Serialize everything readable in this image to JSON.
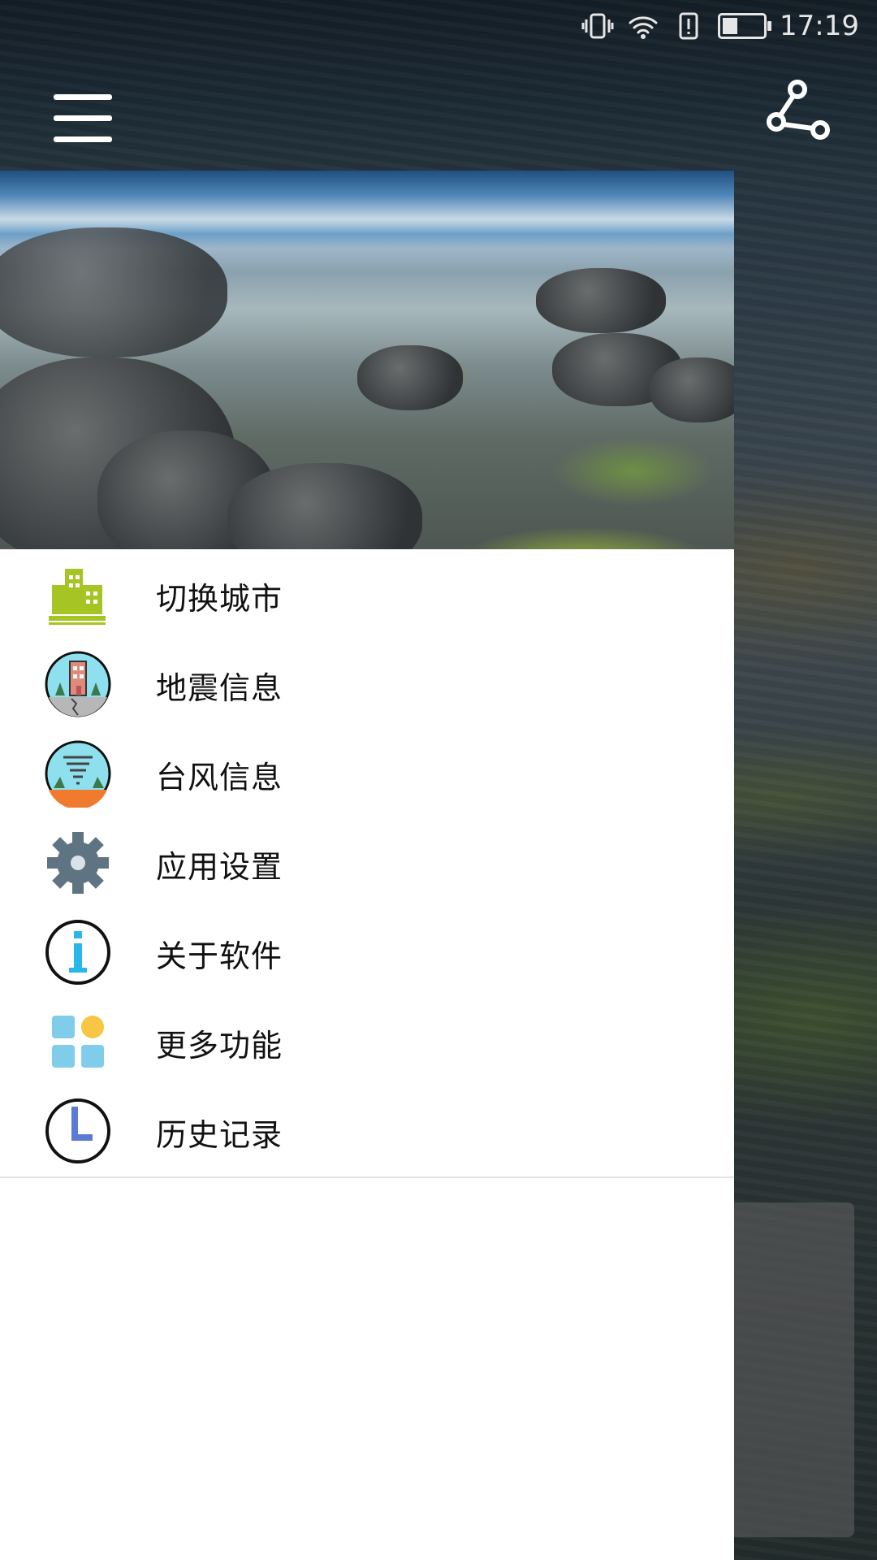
{
  "status_bar": {
    "time": "17:19",
    "icons": [
      "vibrate-icon",
      "wifi-icon",
      "alert-icon",
      "battery-icon"
    ]
  },
  "app_bar": {
    "menu_icon": "hamburger-menu-icon",
    "share_icon": "share-icon"
  },
  "drawer": {
    "header_image": "coastal-rocks-photo",
    "items": [
      {
        "label": "切换城市",
        "icon": "city-buildings-icon"
      },
      {
        "label": "地震信息",
        "icon": "earthquake-icon"
      },
      {
        "label": "台风信息",
        "icon": "typhoon-icon"
      },
      {
        "label": "应用设置",
        "icon": "gear-icon"
      },
      {
        "label": "关于软件",
        "icon": "info-icon"
      },
      {
        "label": "更多功能",
        "icon": "grid-more-icon"
      },
      {
        "label": "历史记录",
        "icon": "clock-history-icon"
      }
    ]
  },
  "colors": {
    "drawer_bg": "#ffffff",
    "text": "#111111",
    "city_icon": "#a6c423",
    "info_icon": "#29b6e8",
    "grid_blue": "#7fcdeb",
    "grid_yellow": "#f6c644"
  }
}
